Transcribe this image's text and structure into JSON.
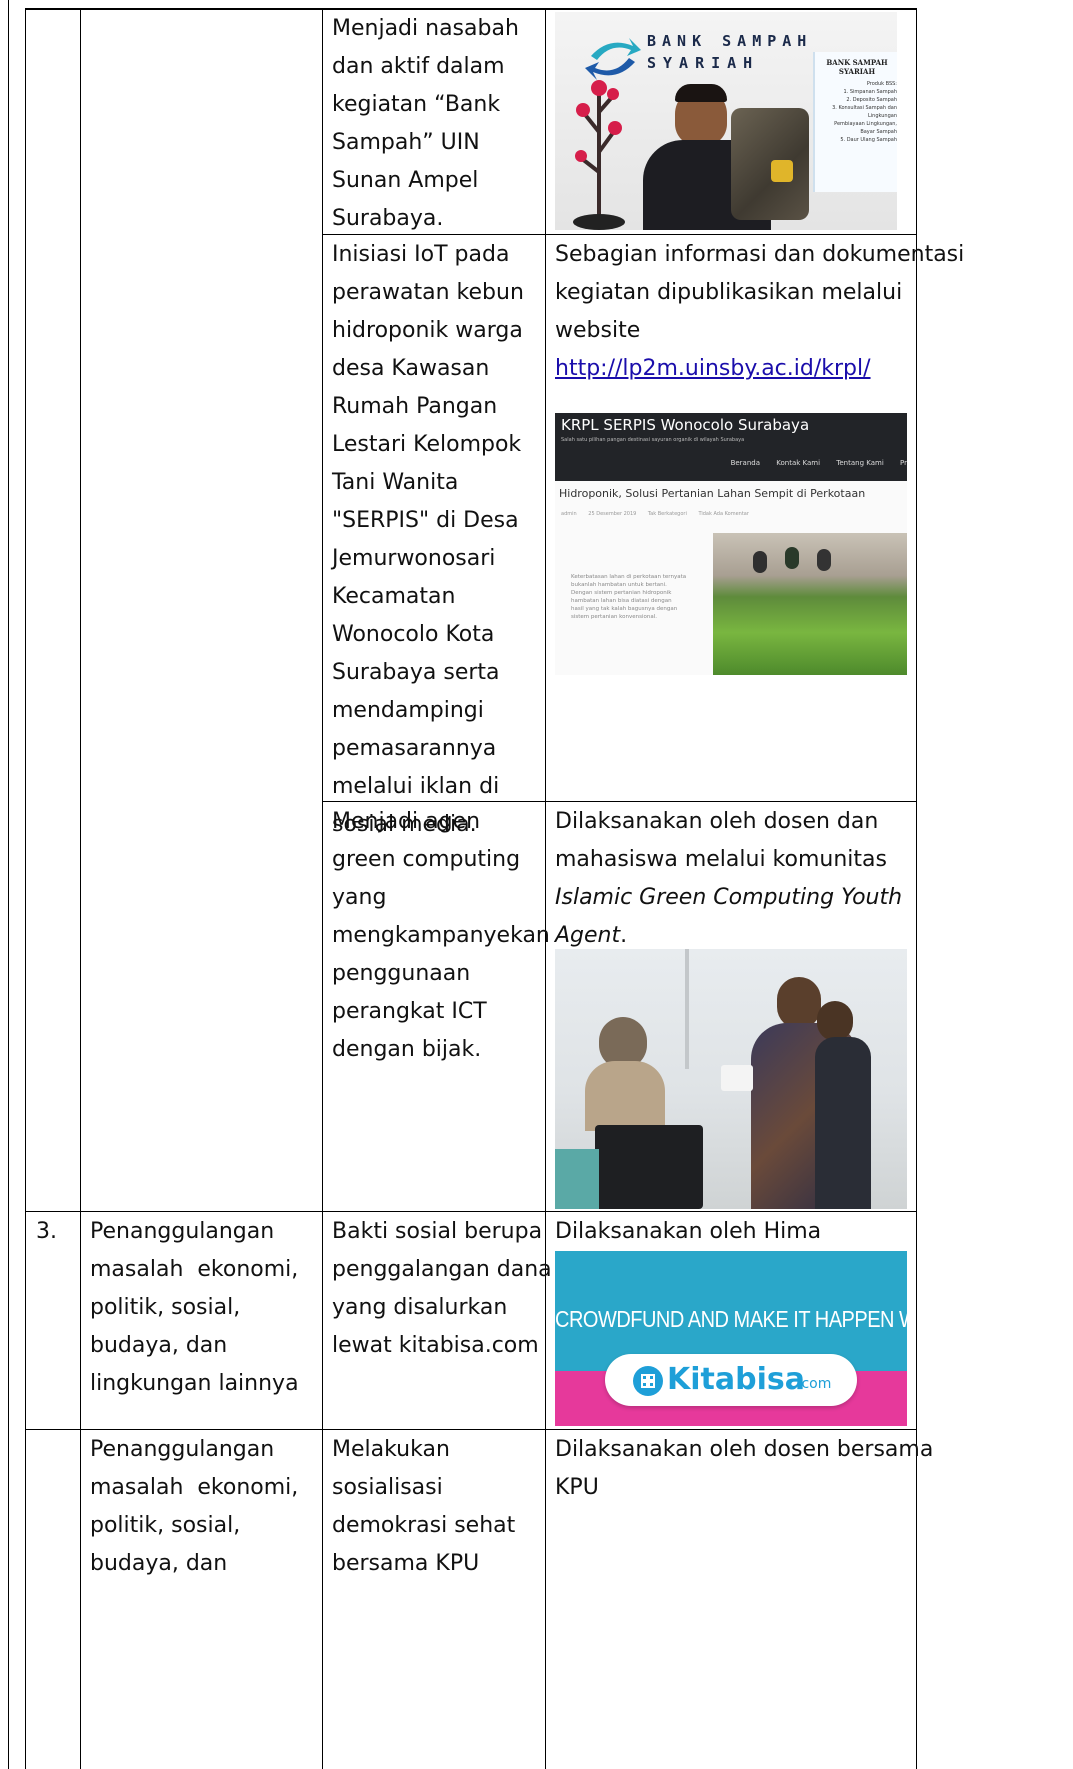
{
  "rows": [
    {
      "activity": [
        "Menjadi nasabah",
        "dan aktif dalam",
        "kegiatan “Bank",
        "Sampah” UIN",
        "Sunan Ampel",
        "Surabaya."
      ],
      "photo": {
        "sign_line1": "BANK SAMPAH",
        "sign_line2": "SYARIAH",
        "poster_title_1": "BANK SAMPAH",
        "poster_title_2": "SYARIAH",
        "poster_lines": [
          "Produk BSS:",
          "1. Simpanan Sampah",
          "2. Deposito Sampah",
          "3. Konsultasi Sampah dan Lingkungan",
          "Pembiayaan Lingkungan, Bayar Sampah",
          "5. Daur Ulang Sampah"
        ]
      }
    },
    {
      "activity": [
        "Inisiasi IoT pada",
        "perawatan kebun",
        "hidroponik warga",
        "desa Kawasan",
        "Rumah Pangan",
        "Lestari Kelompok",
        "Tani Wanita",
        "\"SERPIS\" di Desa",
        "Jemurwonosari",
        "Kecamatan",
        "Wonocolo Kota",
        "Surabaya serta",
        "mendampingi",
        "pemasarannya",
        "melalui iklan di",
        "sosial media."
      ],
      "description": [
        "Sebagian informasi dan dokumentasi",
        "kegiatan dipublikasikan melalui",
        "website"
      ],
      "link": "http://lp2m.uinsby.ac.id/krpl/",
      "website": {
        "site_title": "KRPL SERPIS Wonocolo Surabaya",
        "tagline": "Salah satu pilihan pangan destinasi sayuran organik di wilayah Surabaya",
        "nav": [
          "Beranda",
          "Kontak Kami",
          "Tentang Kami",
          "Pr"
        ],
        "post_title": "Hidroponik, Solusi Pertanian Lahan Sempit di Perkotaan",
        "meta": [
          "admin",
          "25 Desember 2019",
          "Tak Berkategori",
          "Tidak Ada Komentar"
        ],
        "excerpt": [
          "Keterbatasan lahan di perkotaan ternyata",
          "bukanlah hambatan untuk bertani.",
          "Dengan sistem pertanian hidroponik",
          "hambatan lahan bisa diatasi dengan",
          "hasil yang tak kalah bagusnya dengan",
          "sistem pertanian konvensional."
        ]
      }
    },
    {
      "activity": [
        "Menjadi agen",
        "green computing",
        "yang",
        "mengkampanyekan",
        "penggunaan",
        "perangkat ICT",
        "dengan bijak."
      ],
      "description": [
        "Dilaksanakan oleh dosen dan",
        "mahasiswa melalui komunitas"
      ],
      "description_italic": [
        "Islamic Green Computing Youth",
        "Agent"
      ],
      "description_tail": "."
    },
    {
      "number": "3.",
      "field": [
        "Penanggulangan",
        "masalah  ekonomi,",
        "politik, sosial,",
        "budaya, dan",
        "lingkungan lainnya"
      ],
      "activity": [
        "Bakti sosial berupa",
        "penggalangan dana",
        "yang disalurkan",
        "lewat kitabisa.com"
      ],
      "description": [
        "Dilaksanakan oleh Hima"
      ],
      "banner": {
        "headline": "CROWDFUND AND MAKE IT HAPPEN WITH",
        "logo_main": "Kitabisa",
        "logo_suffix": ".com"
      }
    },
    {
      "field": [
        "Penanggulangan",
        "masalah  ekonomi,",
        "politik, sosial,",
        "budaya, dan"
      ],
      "activity": [
        "Melakukan",
        "sosialisasi",
        "demokrasi sehat",
        "bersama KPU"
      ],
      "description": [
        "Dilaksanakan oleh dosen bersama",
        "KPU"
      ]
    }
  ],
  "colors": {
    "banner_top": "#2aa7c9",
    "banner_bottom": "#e6399b",
    "logo_blue": "#1e9fd8",
    "link": "#1a0dab"
  }
}
